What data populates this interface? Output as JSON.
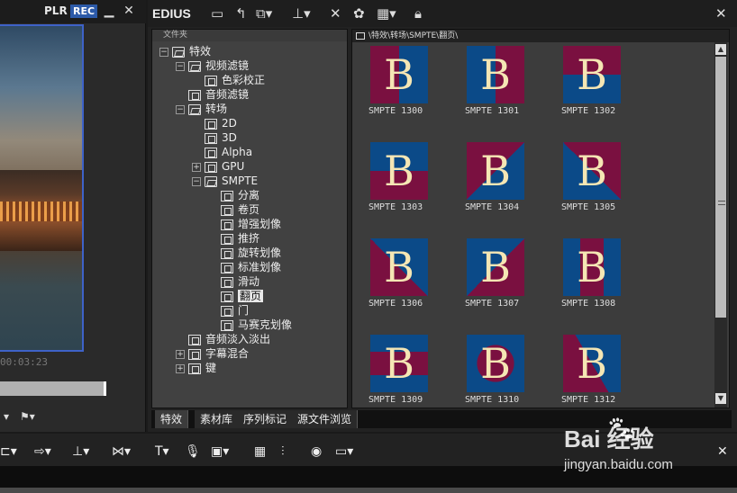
{
  "left_panel": {
    "plr_label": "PLR",
    "rec_label": "REC",
    "minimize_glyph": "▁",
    "close_glyph": "✕",
    "timecode": "00:03:23"
  },
  "fx_window": {
    "title": "EDIUS",
    "close_glyph": "✕",
    "folder_pane": {
      "header": "文件夹",
      "tree": [
        {
          "label": "特效",
          "icon": "folder",
          "expander": "−"
        },
        {
          "label": "视频滤镜",
          "icon": "folder",
          "expander": "−"
        },
        {
          "label": "色彩校正",
          "icon": "film"
        },
        {
          "label": "音频滤镜",
          "icon": "film"
        },
        {
          "label": "转场",
          "icon": "folder",
          "expander": "−"
        },
        {
          "label": "2D",
          "icon": "film"
        },
        {
          "label": "3D",
          "icon": "film"
        },
        {
          "label": "Alpha",
          "icon": "film"
        },
        {
          "label": "GPU",
          "icon": "film",
          "expander": "+"
        },
        {
          "label": "SMPTE",
          "icon": "folder",
          "expander": "−"
        },
        {
          "label": "分离",
          "icon": "film"
        },
        {
          "label": "卷页",
          "icon": "film"
        },
        {
          "label": "增强划像",
          "icon": "film"
        },
        {
          "label": "推挤",
          "icon": "film"
        },
        {
          "label": "旋转划像",
          "icon": "film"
        },
        {
          "label": "标准划像",
          "icon": "film"
        },
        {
          "label": "滑动",
          "icon": "film"
        },
        {
          "label": "翻页",
          "icon": "film",
          "selected": true
        },
        {
          "label": "门",
          "icon": "film"
        },
        {
          "label": "马赛克划像",
          "icon": "film"
        },
        {
          "label": "音频淡入淡出",
          "icon": "film"
        },
        {
          "label": "字幕混合",
          "icon": "text",
          "expander": "+"
        },
        {
          "label": "键",
          "icon": "film",
          "expander": "+"
        }
      ]
    },
    "thumb_pane": {
      "path": "\\特效\\转场\\SMPTE\\翻页\\",
      "items": [
        {
          "caption": "SMPTE 1300",
          "letter": "B"
        },
        {
          "caption": "SMPTE 1301",
          "letter": "B"
        },
        {
          "caption": "SMPTE 1302",
          "letter": "B"
        },
        {
          "caption": "SMPTE 1303",
          "letter": "B"
        },
        {
          "caption": "SMPTE 1304",
          "letter": "B"
        },
        {
          "caption": "SMPTE 1305",
          "letter": "B"
        },
        {
          "caption": "SMPTE 1306",
          "letter": "B"
        },
        {
          "caption": "SMPTE 1307",
          "letter": "B"
        },
        {
          "caption": "SMPTE 1308",
          "letter": "B"
        },
        {
          "caption": "SMPTE 1309",
          "letter": "B"
        },
        {
          "caption": "SMPTE 1310",
          "letter": "B"
        },
        {
          "caption": "SMPTE 1312",
          "letter": "B"
        }
      ]
    },
    "tabs": [
      "特效",
      "素材库",
      "序列标记",
      "源文件浏览"
    ]
  },
  "bottom_bar": {
    "close_glyph": "✕"
  },
  "watermark": {
    "baidu": "Bai  经验",
    "site": "jingyan.baidu.com"
  },
  "colors": {
    "accent_blue": "#3e62c8",
    "smpte_blue": "#0b4a88",
    "smpte_red": "#7a1040",
    "smpte_letter": "#f5e6b4"
  }
}
